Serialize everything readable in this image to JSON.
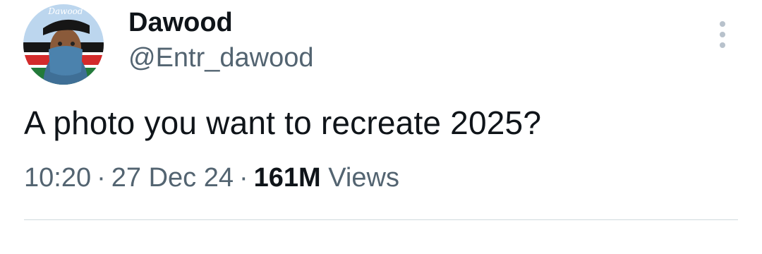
{
  "author": {
    "avatar_badge": "Dawood",
    "name": "Dawood",
    "handle": "@Entr_dawood"
  },
  "tweet": {
    "text": "A photo you want to recreate 2025?",
    "time": "10:20",
    "separator": "·",
    "date": "27 Dec 24",
    "views_count": "161M",
    "views_label": "Views"
  },
  "icons": {
    "more": "more-vertical-icon"
  }
}
